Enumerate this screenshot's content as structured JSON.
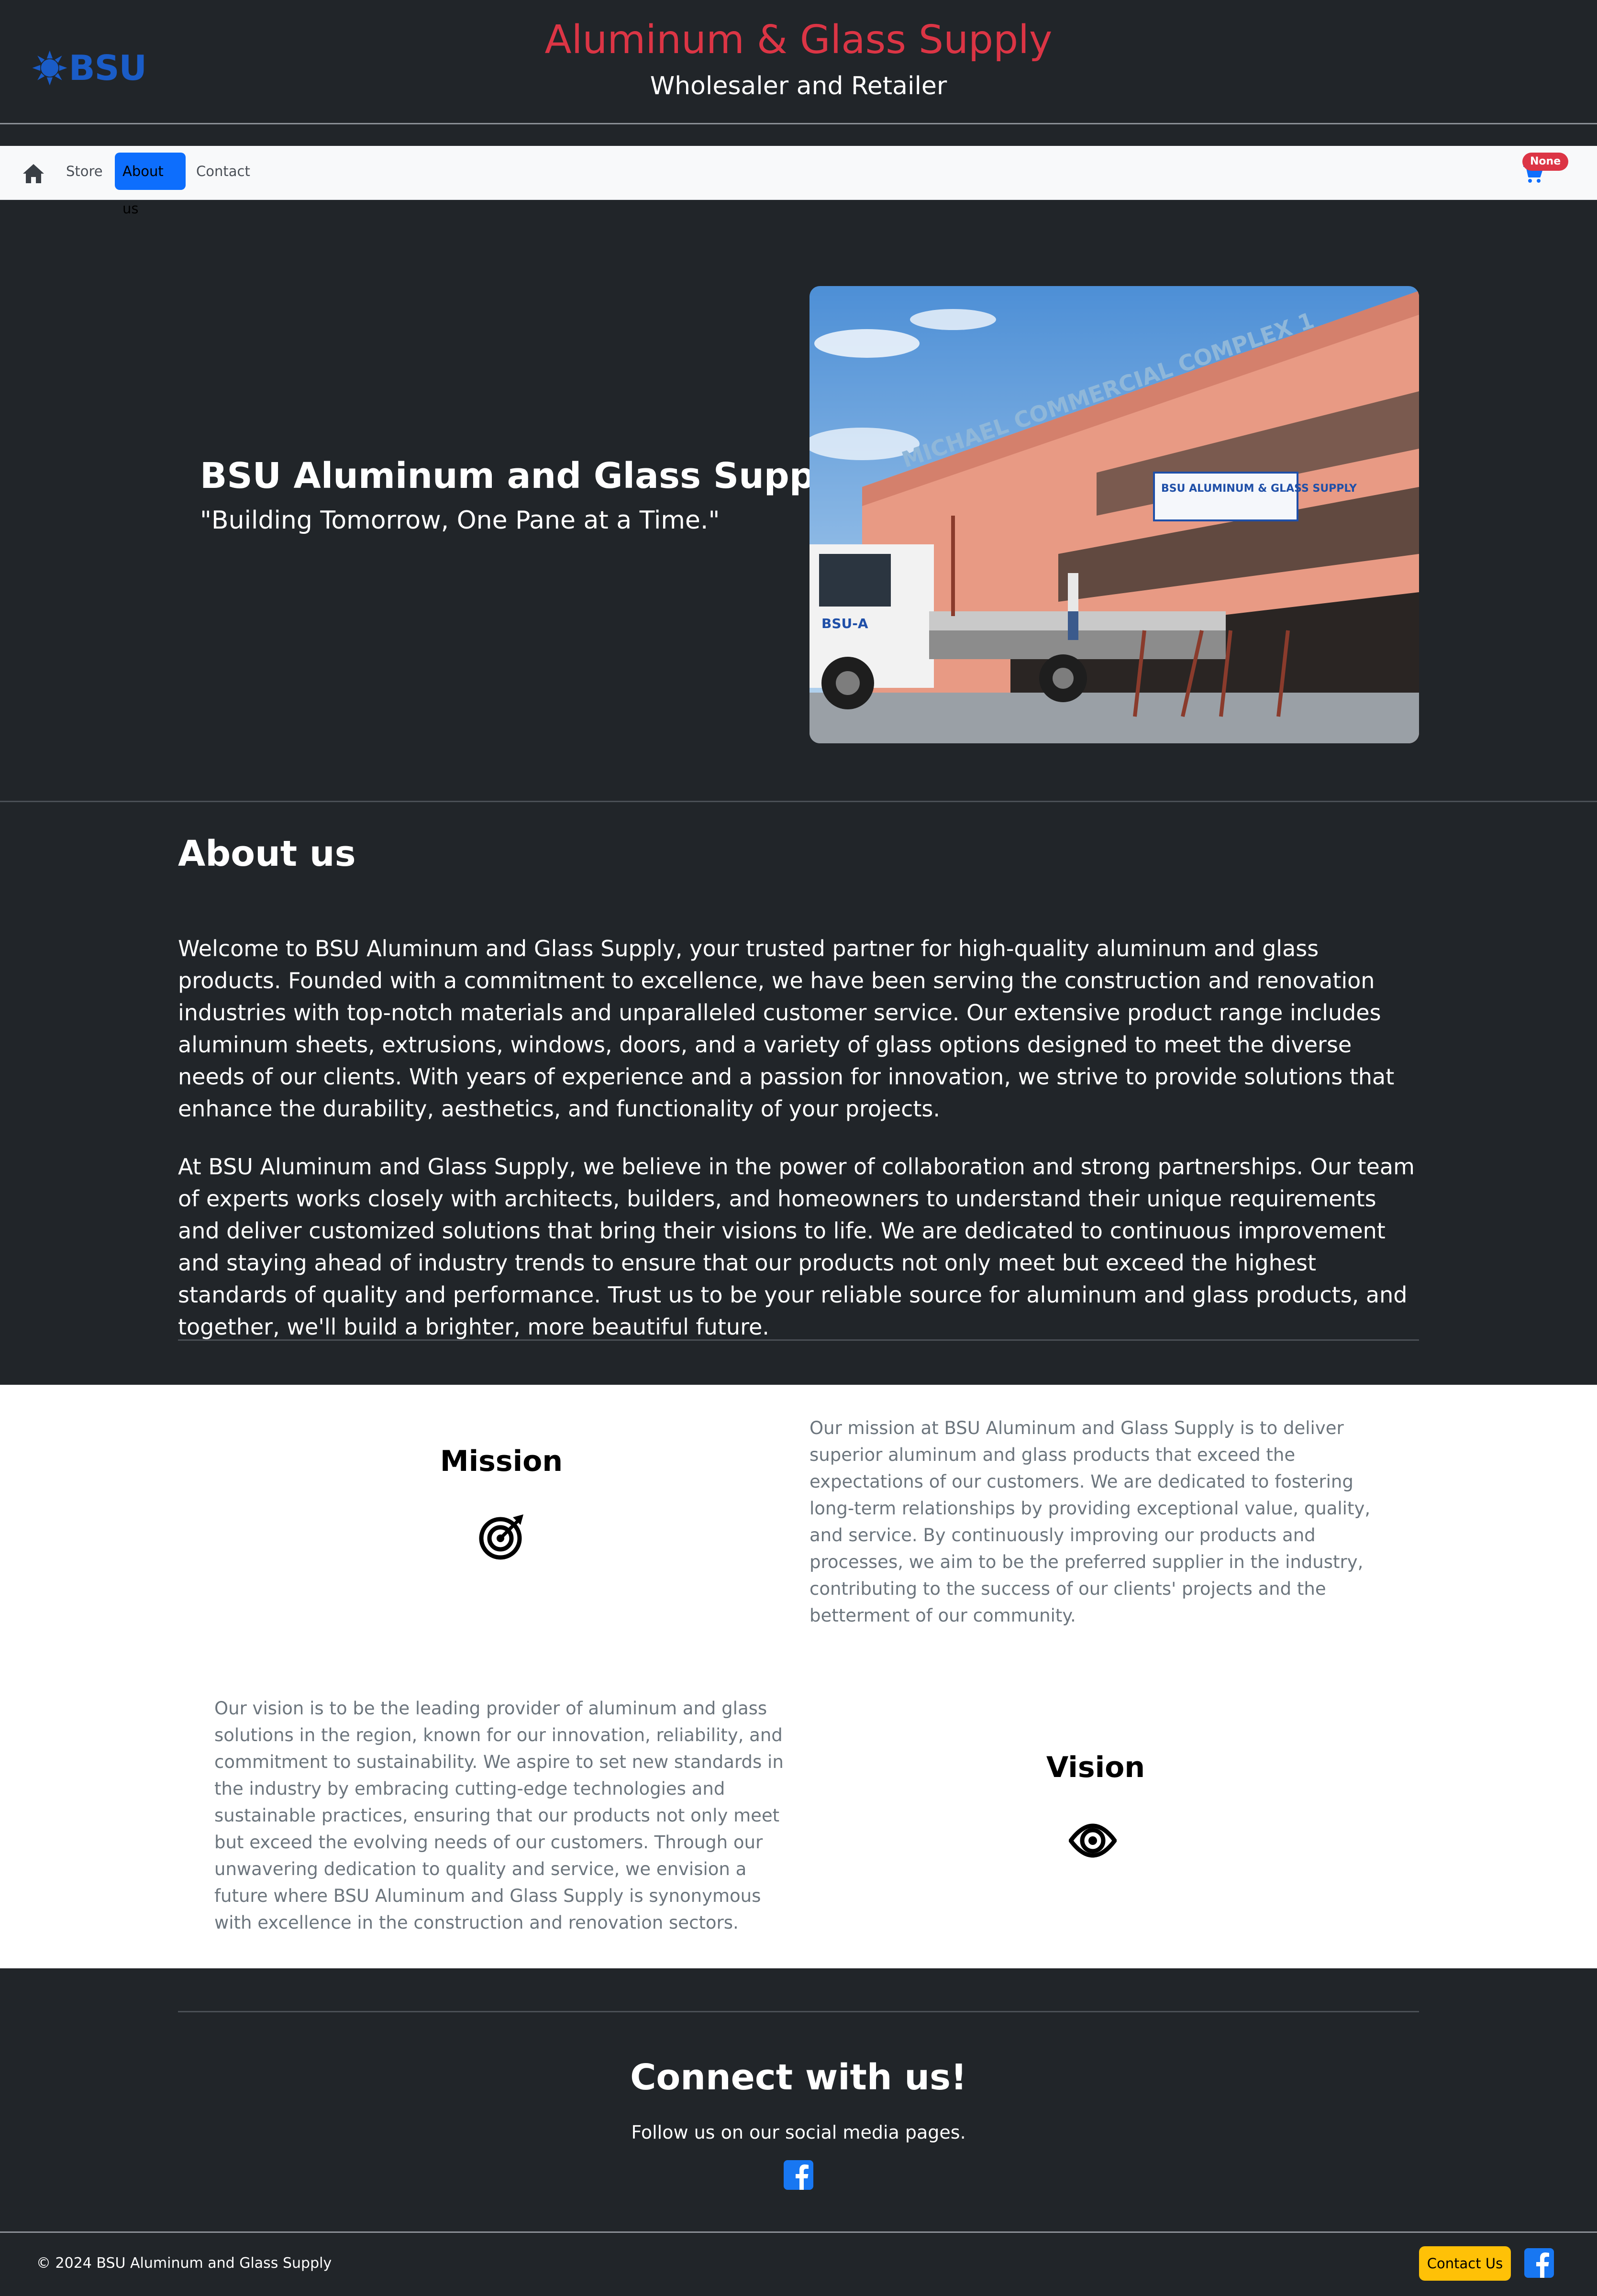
{
  "header": {
    "logo_text": "BSU",
    "title": "Aluminum & Glass Supply",
    "subtitle": "Wholesaler and Retailer"
  },
  "nav": {
    "home_icon": "home-icon",
    "links": [
      "Store",
      "About us",
      "Contact"
    ],
    "active": "About us",
    "cart_icon": "cart-icon",
    "cart_badge": "None"
  },
  "hero": {
    "title": "BSU Aluminum and Glass Supplies",
    "tagline": "\"Building Tomorrow, One Pane at a Time.\"",
    "photo": {
      "building_sign": "MICHAEL COMMERCIAL COMPLEX 1",
      "store_sign": "BSU ALUMINUM & GLASS SUPPLY",
      "truck_label": "BSU-A"
    }
  },
  "about": {
    "heading": "About us",
    "paragraphs": [
      "Welcome to BSU Aluminum and Glass Supply, your trusted partner for high-quality aluminum and glass products. Founded with a commitment to excellence, we have been serving the construction and renovation industries with top-notch materials and unparalleled customer service. Our extensive product range includes aluminum sheets, extrusions, windows, doors, and a variety of glass options designed to meet the diverse needs of our clients. With years of experience and a passion for innovation, we strive to provide solutions that enhance the durability, aesthetics, and functionality of your projects.",
      "At BSU Aluminum and Glass Supply, we believe in the power of collaboration and strong partnerships. Our team of experts works closely with architects, builders, and homeowners to understand their unique requirements and deliver customized solutions that bring their visions to life. We are dedicated to continuous improvement and staying ahead of industry trends to ensure that our products not only meet but exceed the highest standards of quality and performance. Trust us to be your reliable source for aluminum and glass products, and together, we'll build a brighter, more beautiful future."
    ]
  },
  "mission": {
    "heading": "Mission",
    "icon": "target-icon",
    "text": "Our mission at BSU Aluminum and Glass Supply is to deliver superior aluminum and glass products that exceed the expectations of our customers. We are dedicated to fostering long-term relationships by providing exceptional value, quality, and service. By continuously improving our products and processes, we aim to be the preferred supplier in the industry, contributing to the success of our clients' projects and the betterment of our community."
  },
  "vision": {
    "heading": "Vision",
    "icon": "eye-icon",
    "text": "Our vision is to be the leading provider of aluminum and glass solutions in the region, known for our innovation, reliability, and commitment to sustainability. We aspire to set new standards in the industry by embracing cutting-edge technologies and sustainable practices, ensuring that our products not only meet but exceed the evolving needs of our customers. Through our unwavering dedication to quality and service, we envision a future where BSU Aluminum and Glass Supply is synonymous with excellence in the construction and renovation sectors."
  },
  "connect": {
    "title": "Connect with us!",
    "subtitle": "Follow us on our social media pages.",
    "icon": "facebook-icon"
  },
  "footer": {
    "copyright": "© 2024 BSU Aluminum and Glass Supply",
    "contact_button": "Contact Us",
    "icon": "facebook-icon"
  },
  "colors": {
    "dark_bg": "#212529",
    "title_red": "#dc3545",
    "primary_blue": "#0d6efd",
    "warning_yellow": "#ffc107",
    "muted_text": "#6c757d",
    "facebook_blue": "#1877f2"
  }
}
